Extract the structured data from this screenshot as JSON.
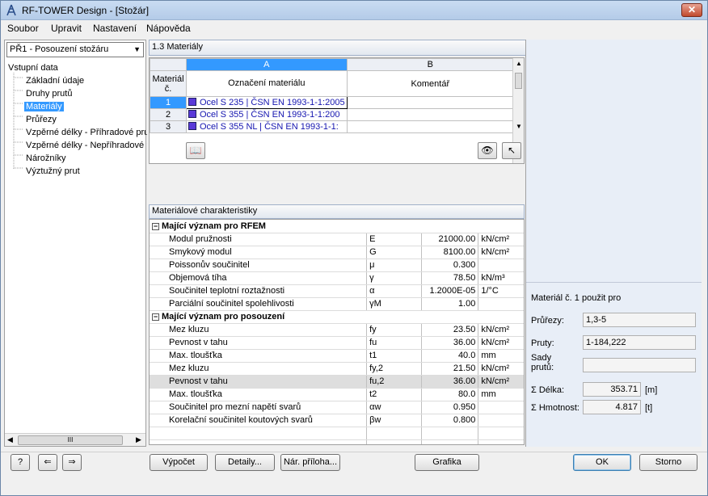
{
  "window": {
    "title": "RF-TOWER Design - [Stožár]",
    "close_label": "✕"
  },
  "menu": [
    "Soubor",
    "Upravit",
    "Nastavení",
    "Nápověda"
  ],
  "nav": {
    "case_combo": "PŘ1 - Posouzení stožáru",
    "tree_root": "Vstupní data",
    "tree_items": [
      "Základní údaje",
      "Druhy prutů",
      "Materiály",
      "Průřezy",
      "Vzpěrné délky - Příhradové pru",
      "Vzpěrné délky - Nepříhradové p",
      "Nárožníky",
      "Výztužný prut"
    ],
    "selected_index": 2,
    "scroll_thumb": "III"
  },
  "section_title": "1.3 Materiály",
  "materials_grid": {
    "col_a": "A",
    "col_b": "B",
    "rowhead_label": "Materiál č.",
    "col_a_label": "Označení materiálu",
    "col_b_label": "Komentář",
    "rows": [
      {
        "num": "1",
        "name": "Ocel S 235 | ČSN EN 1993-1-1:2005"
      },
      {
        "num": "2",
        "name": "Ocel S 355 | ČSN EN 1993-1-1:200"
      },
      {
        "num": "3",
        "name": "Ocel S 355 NL | ČSN EN 1993-1-1:"
      }
    ]
  },
  "char_title": "Materiálové charakteristiky",
  "groups": [
    {
      "title": "Mající význam pro RFEM",
      "rows": [
        {
          "name": "Modul pružnosti",
          "sym": "E",
          "val": "21000.00",
          "unit": "kN/cm²"
        },
        {
          "name": "Smykový modul",
          "sym": "G",
          "val": "8100.00",
          "unit": "kN/cm²"
        },
        {
          "name": "Poissonův součinitel",
          "sym": "μ",
          "val": "0.300",
          "unit": ""
        },
        {
          "name": "Objemová tíha",
          "sym": "γ",
          "val": "78.50",
          "unit": "kN/m³"
        },
        {
          "name": "Součinitel teplotní roztažnosti",
          "sym": "α",
          "val": "1.2000E-05",
          "unit": "1/°C"
        },
        {
          "name": "Parciální součinitel spolehlivosti",
          "sym": "γM",
          "val": "1.00",
          "unit": ""
        }
      ]
    },
    {
      "title": "Mající význam pro posouzení",
      "rows": [
        {
          "name": "Mez kluzu",
          "sym": "fy",
          "val": "23.50",
          "unit": "kN/cm²"
        },
        {
          "name": "Pevnost v tahu",
          "sym": "fu",
          "val": "36.00",
          "unit": "kN/cm²"
        },
        {
          "name": "Max. tloušťka",
          "sym": "t1",
          "val": "40.0",
          "unit": "mm"
        },
        {
          "name": "Mez kluzu",
          "sym": "fy,2",
          "val": "21.50",
          "unit": "kN/cm²"
        },
        {
          "name": "Pevnost v tahu",
          "sym": "fu,2",
          "val": "36.00",
          "unit": "kN/cm²"
        },
        {
          "name": "Max. tloušťka",
          "sym": "t2",
          "val": "80.0",
          "unit": "mm"
        },
        {
          "name": "Součinitel pro mezní napětí svarů",
          "sym": "αw",
          "val": "0.950",
          "unit": ""
        },
        {
          "name": "Korelační součinitel koutových svarů",
          "sym": "βw",
          "val": "0.800",
          "unit": ""
        }
      ]
    }
  ],
  "usage": {
    "title": "Materiál č. 1 použit pro",
    "cross_sections_label": "Průřezy:",
    "cross_sections_value": "1,3-5",
    "members_label": "Pruty:",
    "members_value": "1-184,222",
    "sets_label": "Sady prutů:",
    "sets_value": "",
    "length_label": "Σ Délka:",
    "length_value": "353.71",
    "length_unit": "[m]",
    "mass_label": "Σ Hmotnost:",
    "mass_value": "4.817",
    "mass_unit": "[t]"
  },
  "buttons": {
    "calc": "Výpočet",
    "details": "Detaily...",
    "annex": "Nár. příloha...",
    "graphics": "Grafika",
    "ok": "OK",
    "cancel": "Storno"
  }
}
